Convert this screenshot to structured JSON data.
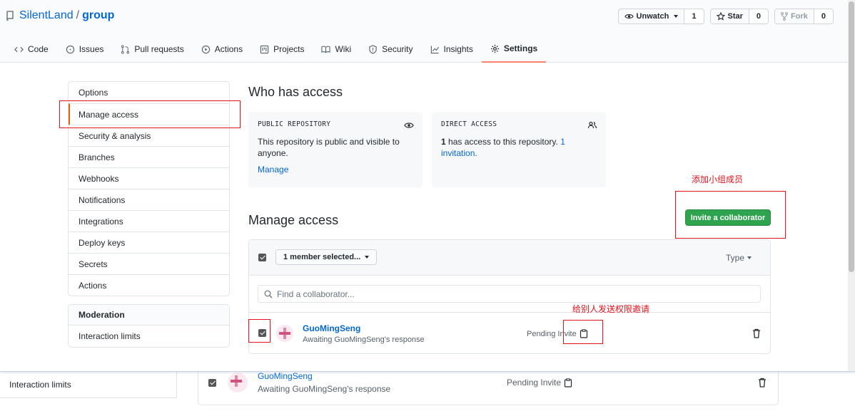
{
  "repo": {
    "owner": "SilentLand",
    "separator": "/",
    "name": "group"
  },
  "actions": {
    "watch": {
      "label": "Unwatch",
      "count": "1"
    },
    "star": {
      "label": "Star",
      "count": "0"
    },
    "fork": {
      "label": "Fork",
      "count": "0"
    }
  },
  "tabs": [
    {
      "label": "Code",
      "icon": "code-icon"
    },
    {
      "label": "Issues",
      "icon": "issue-icon"
    },
    {
      "label": "Pull requests",
      "icon": "pull-request-icon"
    },
    {
      "label": "Actions",
      "icon": "play-icon"
    },
    {
      "label": "Projects",
      "icon": "project-icon"
    },
    {
      "label": "Wiki",
      "icon": "book-icon"
    },
    {
      "label": "Security",
      "icon": "shield-icon"
    },
    {
      "label": "Insights",
      "icon": "graph-icon"
    },
    {
      "label": "Settings",
      "icon": "gear-icon",
      "active": true
    }
  ],
  "sidebar": {
    "items": [
      {
        "label": "Options"
      },
      {
        "label": "Manage access",
        "active": true
      },
      {
        "label": "Security & analysis"
      },
      {
        "label": "Branches"
      },
      {
        "label": "Webhooks"
      },
      {
        "label": "Notifications"
      },
      {
        "label": "Integrations"
      },
      {
        "label": "Deploy keys"
      },
      {
        "label": "Secrets"
      },
      {
        "label": "Actions"
      }
    ],
    "moderation": {
      "heading": "Moderation",
      "items": [
        {
          "label": "Interaction limits"
        }
      ]
    }
  },
  "who_has_access": {
    "title": "Who has access",
    "public_card": {
      "label": "PUBLIC REPOSITORY",
      "icon": "eye-icon",
      "text": "This repository is public and visible to anyone.",
      "link": "Manage"
    },
    "direct_card": {
      "label": "DIRECT ACCESS",
      "icon": "people-icon",
      "count": "1",
      "text": " has access to this repository. ",
      "link": "1 invitation."
    }
  },
  "annotations": {
    "add_member": "添加小组成员",
    "send_invite": "给别人发送权限邀请"
  },
  "manage_access": {
    "title": "Manage access",
    "invite_button": "Invite a collaborator",
    "select_label": "1 member selected...",
    "type_label": "Type",
    "search_placeholder": "Find a collaborator...",
    "members": [
      {
        "name": "GuoMingSeng",
        "status": "Awaiting GuoMingSeng's response",
        "pending": "Pending Invite",
        "checked": true
      }
    ]
  },
  "colors": {
    "accent_link": "#0366d6",
    "invite_green": "#2ea44f",
    "annotation_red": "#e0141e",
    "active_tab_underline": "#f9826c"
  }
}
